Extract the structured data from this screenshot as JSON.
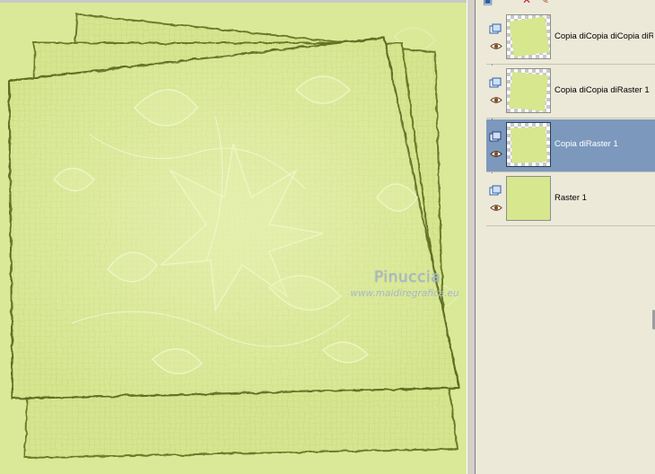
{
  "canvas": {
    "background": "#eef0e4",
    "texture_color": "#d8e893",
    "edge_color": "#6b7a2b",
    "watermark_name": "Pinuccia",
    "watermark_url": "www.maidiregrafica.eu"
  },
  "layers_panel": {
    "toolbar_icons": [
      "new-layer-icon",
      "delete-icon",
      "edit-icon"
    ],
    "selected_color": "#7c98bc",
    "layers": [
      {
        "name": "Copia diCopia diCopia diR",
        "selected": false,
        "thumb": "rotated-square"
      },
      {
        "name": "Copia diCopia diRaster 1",
        "selected": false,
        "thumb": "rotated-square"
      },
      {
        "name": "Copia diRaster 1",
        "selected": true,
        "thumb": "rotated-square"
      },
      {
        "name": "Raster 1",
        "selected": false,
        "thumb": "full"
      }
    ]
  }
}
